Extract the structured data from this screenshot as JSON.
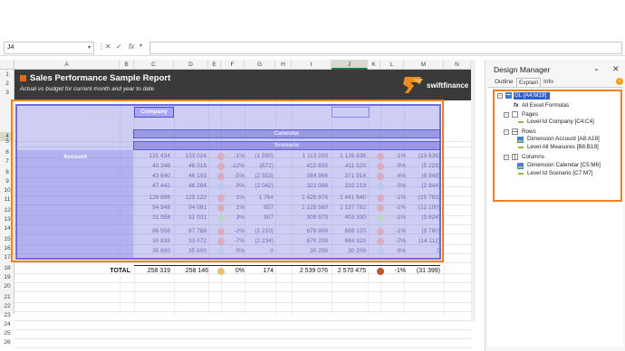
{
  "formula_bar": {
    "name_box": "J4",
    "fx": "fx",
    "formula": ""
  },
  "columns": [
    "A",
    "B",
    "C",
    "D",
    "E",
    "F",
    "G",
    "H",
    "I",
    "J",
    "K",
    "L",
    "M",
    "N"
  ],
  "rows": [
    "1",
    "2",
    "3",
    "4",
    "5",
    "6",
    "7",
    "8",
    "9",
    "10",
    "11",
    "12",
    "13",
    "14",
    "15",
    "16",
    "17",
    "18",
    "19",
    "20",
    "21",
    "22",
    "23",
    "24",
    "25",
    "26"
  ],
  "banner": {
    "title": "Sales Performance Sample Report",
    "subtitle": "Actual vs budget for current month and year to date",
    "logo_text": "swiftfinance"
  },
  "report": {
    "company_label": "Company",
    "company_box": "Company",
    "calendar_label": "Calendar",
    "scenario_label": "Scenario",
    "account_label": "Account",
    "data_rows": [
      [
        "131 434",
        "133 024",
        "-1%",
        "(1 590)",
        "1 113 200",
        "1 126 836",
        "-1%",
        "(13 636)"
      ],
      [
        "40 346",
        "46 018",
        "-12%",
        "(672)",
        "410 895",
        "411 520",
        "0%",
        "(5 225)"
      ],
      [
        "43 640",
        "46 193",
        "-5%",
        "(2 553)",
        "384 966",
        "371 914",
        "4%",
        "(8 948)"
      ],
      [
        "47 442",
        "46 284",
        "0%",
        "(2 042)",
        "322 099",
        "333 219",
        "0%",
        "(2 944)"
      ],
      [
        "126 896",
        "125 122",
        "1%",
        "1 764",
        "1 425 876",
        "1 441 640",
        "-1%",
        "(15 763)"
      ],
      [
        "94 948",
        "94 091",
        "1%",
        "857",
        "1 125 560",
        "1 137 762",
        "-1%",
        "(12 100)"
      ],
      [
        "31 958",
        "31 031",
        "3%",
        "907",
        "309 573",
        "403 330",
        "-1%",
        "(3 624)"
      ],
      [
        "86 558",
        "87 768",
        "-2%",
        "(1 210)",
        "678 908",
        "688 120",
        "-1%",
        "(9 760)"
      ],
      [
        "30 838",
        "33 072",
        "-7%",
        "(2 234)",
        "670 208",
        "684 320",
        "-2%",
        "(14 112)"
      ],
      [
        "35 600",
        "35 600",
        "0%",
        "0",
        "30 208",
        "30 208",
        "0%",
        "0"
      ]
    ],
    "total": {
      "label": "TOTAL",
      "c": "258 319",
      "d": "258 146",
      "pct1": "0%",
      "g": "174",
      "i": "2 539 076",
      "j": "2 570 475",
      "pct2": "-1%",
      "m": "(31 399)"
    }
  },
  "design_manager": {
    "title": "Design Manager",
    "tabs": [
      "Outline",
      "Explain",
      "Info"
    ],
    "active_tab": "Explain",
    "tree": {
      "root": "GL [A4:M19]",
      "all_formulas": "All Excel Formulas",
      "pages": "Pages",
      "pages_child": "Level Id Company [C4:C4]",
      "rows": "Rows",
      "rows_child1": "Dimension Account [A8:A19]",
      "rows_child2": "Level All Measures [B8:B19]",
      "columns": "Columns",
      "columns_child1": "Dimension Calendar [C5:M6]",
      "columns_child2": "Level Id Scenario [C7:M7]"
    }
  },
  "colors": {
    "accent_orange": "#f07f1e",
    "banner": "#3a3a3a",
    "overlay": "#7d7de6",
    "highlight": "#2f5fcf"
  }
}
